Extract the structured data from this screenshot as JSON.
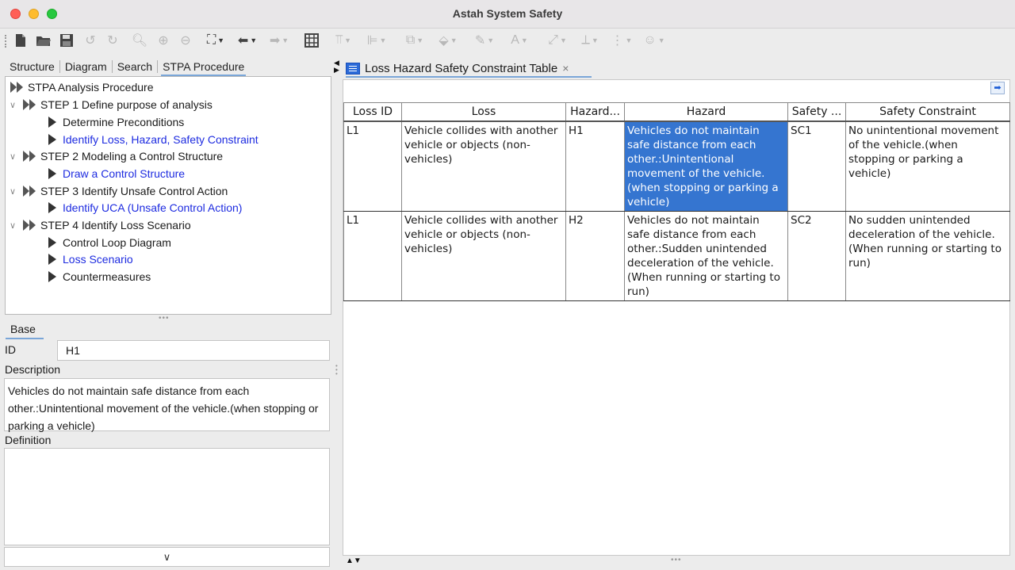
{
  "window": {
    "title": "Astah System Safety"
  },
  "toolbar": {
    "icons": [
      "new-file-icon",
      "open-folder-icon",
      "save-icon",
      "undo-icon",
      "redo-icon",
      "zoom-icon",
      "zoom-in-icon",
      "zoom-out-icon",
      "fit-window-icon",
      "back-arrow-icon",
      "forward-arrow-icon",
      "grid-icon",
      "align-top-icon",
      "align-left-icon",
      "arrange-icon",
      "fill-color-icon",
      "line-color-icon",
      "font-color-icon",
      "line-style-icon",
      "tree-layout-icon",
      "layout-icon",
      "emoji-icon"
    ]
  },
  "left_tabs": [
    "Structure",
    "Diagram",
    "Search",
    "STPA Procedure"
  ],
  "tree": {
    "root": "STPA Analysis Procedure",
    "steps": [
      {
        "label": "STEP 1 Define purpose of analysis",
        "children": [
          "Determine Preconditions",
          "Identify Loss, Hazard, Safety Constraint"
        ]
      },
      {
        "label": "STEP 2 Modeling a Control Structure",
        "children": [
          "Draw a Control Structure"
        ]
      },
      {
        "label": "STEP 3 Identify Unsafe Control Action",
        "children": [
          "Identify UCA (Unsafe Control Action)"
        ]
      },
      {
        "label": "STEP 4 Identify Loss Scenario",
        "children": [
          "Control Loop Diagram",
          "Loss Scenario",
          "Countermeasures"
        ]
      }
    ]
  },
  "properties": {
    "tab": "Base",
    "id_label": "ID",
    "id_value": "H1",
    "description_label": "Description",
    "description": "Vehicles do not maintain safe distance from each other.:Unintentional movement of the vehicle.(when stopping or parking a vehicle)",
    "definition_label": "Definition",
    "definition": "",
    "more_glyph": "∨"
  },
  "editor_tab": {
    "label": "Loss Hazard Safety Constraint Table",
    "close": "×"
  },
  "table": {
    "columns": [
      "Loss ID",
      "Loss",
      "Hazard...",
      "Hazard",
      "Safety ...",
      "Safety Constraint"
    ],
    "rows": [
      [
        "L1",
        "Vehicle collides with another vehicle or objects (non-vehicles)",
        "H1",
        "Vehicles do not maintain safe distance from each other.:Unintentional movement of the vehicle.(when stopping or parking a vehicle)",
        "SC1",
        "No unintentional movement of the vehicle.(when stopping or parking a vehicle)"
      ],
      [
        "L1",
        "Vehicle collides with another vehicle or objects (non-vehicles)",
        "H2",
        "Vehicles do not maintain safe distance from each other.:Sudden unintended deceleration of the vehicle.(When running or starting to run)",
        "SC2",
        "No sudden unintended deceleration of the vehicle.(When running or starting to run)"
      ]
    ],
    "selected": {
      "row": 0,
      "col": 3
    }
  },
  "colors": {
    "selection": "#3575d0",
    "link": "#1d2be0",
    "tab_underline": "#7aa6d8"
  }
}
